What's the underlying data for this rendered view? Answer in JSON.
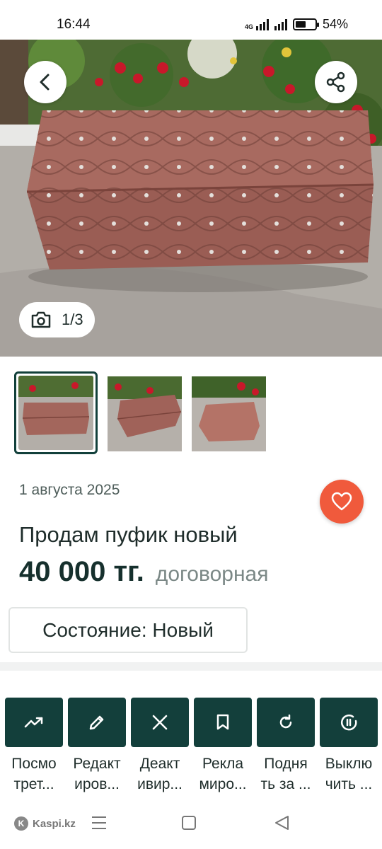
{
  "status": {
    "time": "16:44",
    "network": "4G",
    "battery_percent": "54%",
    "battery_level": 0.54
  },
  "gallery": {
    "counter": "1/3",
    "thumbnail_count": 3,
    "selected_index": 0
  },
  "listing": {
    "date": "1 августа 2025",
    "title": "Продам пуфик новый",
    "price": "40 000 тг.",
    "negotiable": "договорная",
    "condition": "Состояние: Новый"
  },
  "actions": [
    {
      "label": "Посмо\nтрет...",
      "icon": "trending-up-icon"
    },
    {
      "label": "Редакт\nиров...",
      "icon": "pencil-icon"
    },
    {
      "label": "Деакт\nивир...",
      "icon": "close-icon"
    },
    {
      "label": "Рекла\nмиро...",
      "icon": "bookmark-icon"
    },
    {
      "label": "Подня\nть за ...",
      "icon": "refresh-icon"
    },
    {
      "label": "Выклю\nчить ...",
      "icon": "power-pause-icon"
    }
  ],
  "navbar": {
    "brand": "Kaspi.kz"
  },
  "colors": {
    "accent_dark": "#133f3b",
    "favorite": "#f05a3c"
  }
}
